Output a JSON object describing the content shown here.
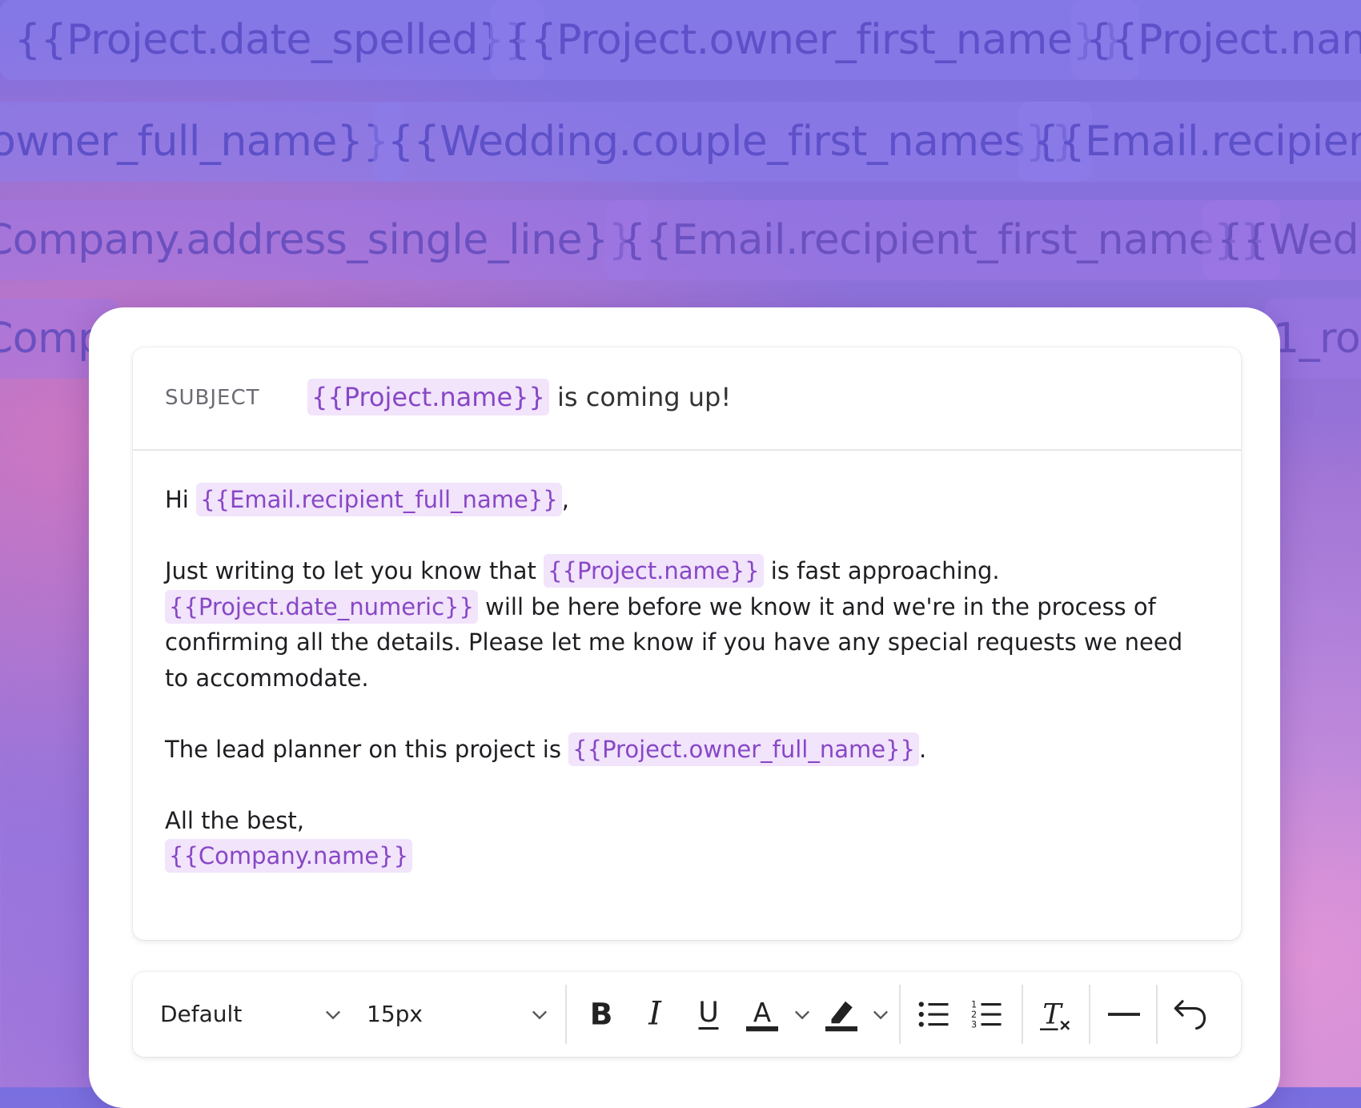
{
  "background_tokens": {
    "row1": [
      "{{Project.date_spelled}}",
      "{{Project.owner_first_name}}",
      "{{Project.name"
    ],
    "row2": [
      "owner_full_name}}",
      "{{Wedding.couple_first_names}}",
      "{{Email.recipient_"
    ],
    "row3": [
      "Company.address_single_line}}",
      "{{Email.recipient_first_name}}",
      "{{Weddi"
    ],
    "row4": [
      "Comp",
      "1_ro"
    ]
  },
  "subject": {
    "label": "SUBJECT",
    "token": "{{Project.name}}",
    "text": "is coming up!"
  },
  "body": {
    "greeting": "Hi",
    "greeting_token": "{{Email.recipient_full_name}}",
    "greeting_punct": ",",
    "p1_a": "Just writing to let you know that",
    "p1_token1": "{{Project.name}}",
    "p1_b": "is fast approaching.",
    "p1_token2": "{{Project.date_numeric}}",
    "p1_c": "will be here before we know it and we're in the process of confirming all the details. Please let me know if you have any special requests we need to accommodate.",
    "p2_a": "The lead planner on this project is",
    "p2_token": "{{Project.owner_full_name}}",
    "p2_b": ".",
    "signoff": "All the best,",
    "signoff_token": "{{Company.name}}"
  },
  "toolbar": {
    "font_family": "Default",
    "font_size": "15px",
    "buttons": [
      "bold-icon",
      "italic-icon",
      "underline-icon",
      "text-color-icon",
      "highlight-icon",
      "bullet-list-icon",
      "numbered-list-icon",
      "clear-format-icon",
      "horizontal-rule-icon",
      "undo-icon"
    ]
  },
  "colors": {
    "token_bg": "#f1e4fb",
    "token_text": "#8847c6",
    "background_chip_text": "#5d50c8"
  }
}
